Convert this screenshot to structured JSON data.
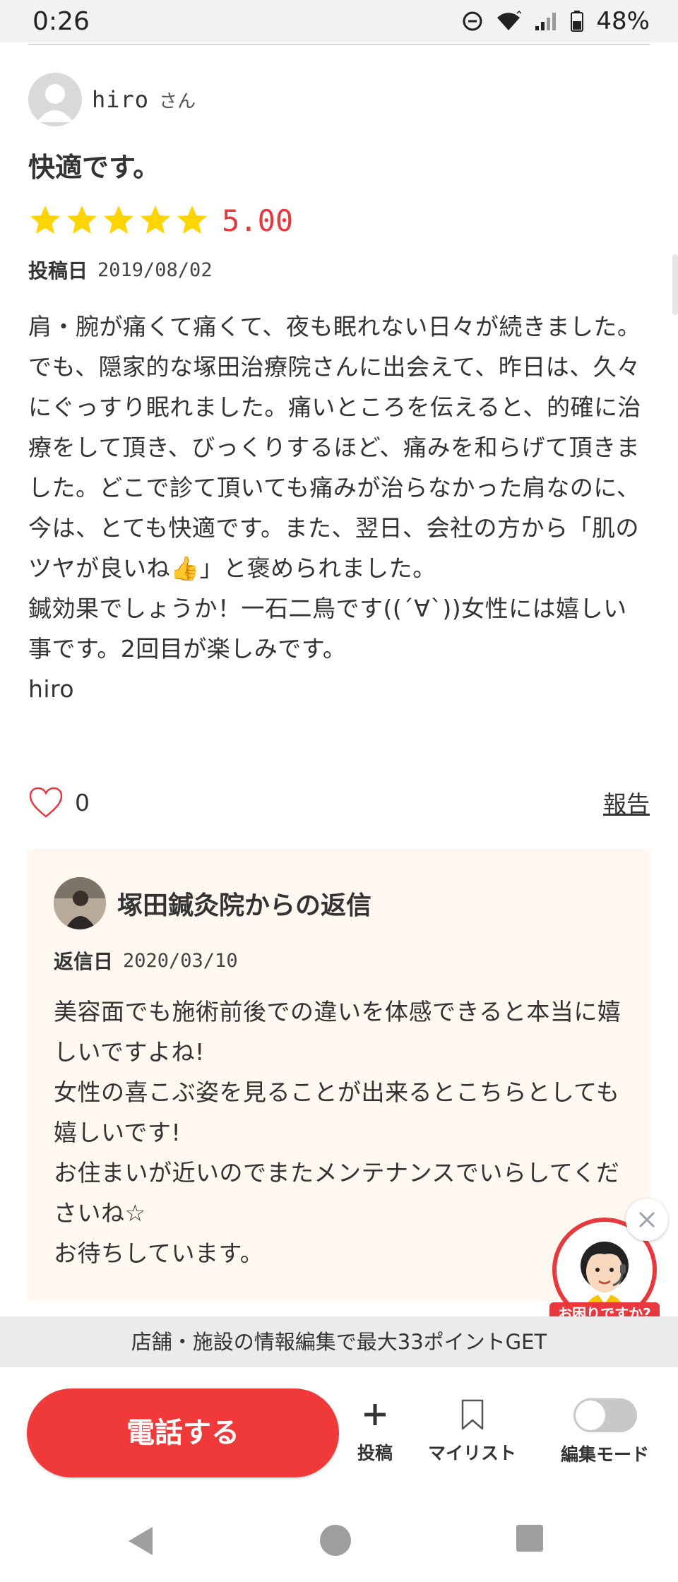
{
  "status_bar": {
    "time": "0:26",
    "battery": "48%"
  },
  "review": {
    "username": "hiro",
    "honorific": "さん",
    "title": "快適です。",
    "rating": 5,
    "rating_text": "5.00",
    "date_label": "投稿日",
    "date": "2019/08/02",
    "body": "肩・腕が痛くて痛くて、夜も眠れない日々が続きました。でも、隠家的な塚田治療院さんに出会えて、昨日は、久々にぐっすり眠れました。痛いところを伝えると、的確に治療をして頂き、びっくりするほど、痛みを和らげて頂きました。どこで診て頂いても痛みが治らなかった肩なのに、今は、とても快適です。また、翌日、会社の方から「肌のツヤが良いね👍」と褒められました。\n鍼効果でしょうか！一石二鳥です((´∀`))女性には嬉しい事です。2回目が楽しみです。\nhiro",
    "like_count": "0",
    "report_label": "報告"
  },
  "reply": {
    "title": "塚田鍼灸院からの返信",
    "date_label": "返信日",
    "date": "2020/03/10",
    "body": "美容面でも施術前後での違いを体感できると本当に嬉しいですよね!\n女性の喜こぶ姿を見ることが出来るとこちらとしても嬉しいです!\nお住まいが近いのでまたメンテナンスでいらしてくださいね☆\nお待ちしています。"
  },
  "help_widget": {
    "label": "お困りですか?"
  },
  "promo": {
    "text": "店舗・施設の情報編集で最大33ポイントGET"
  },
  "actions": {
    "call_label": "電話する",
    "post_label": "投稿",
    "mylist_label": "マイリスト",
    "edit_mode_label": "編集モード",
    "edit_mode_on": false
  },
  "colors": {
    "accent": "#e8383d",
    "call_button": "#f03a3a",
    "star": "#ffd400",
    "reply_bg": "#fff8f0"
  }
}
